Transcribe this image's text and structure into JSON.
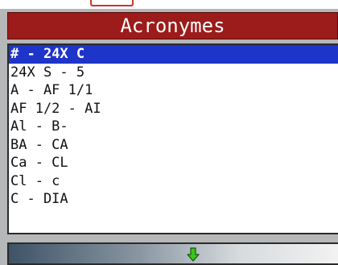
{
  "header": {
    "title": "Acronymes"
  },
  "list": {
    "items": [
      {
        "label": "# - 24X C",
        "selected": true
      },
      {
        "label": "24X S - 5",
        "selected": false
      },
      {
        "label": "A - AF 1/1",
        "selected": false
      },
      {
        "label": "AF 1/2 - AI",
        "selected": false
      },
      {
        "label": "Al - B-",
        "selected": false
      },
      {
        "label": "BA - CA",
        "selected": false
      },
      {
        "label": "Ca - CL",
        "selected": false
      },
      {
        "label": "Cl - c",
        "selected": false
      },
      {
        "label": "C - DIA",
        "selected": false
      }
    ]
  },
  "footer": {
    "scroll_icon": "down-arrow-icon",
    "arrow_color": "#3cc41e"
  },
  "colors": {
    "title_bg": "#9b1c1a",
    "selection_bg": "#1f35c9",
    "screen_bg": "#b5b7b9"
  }
}
